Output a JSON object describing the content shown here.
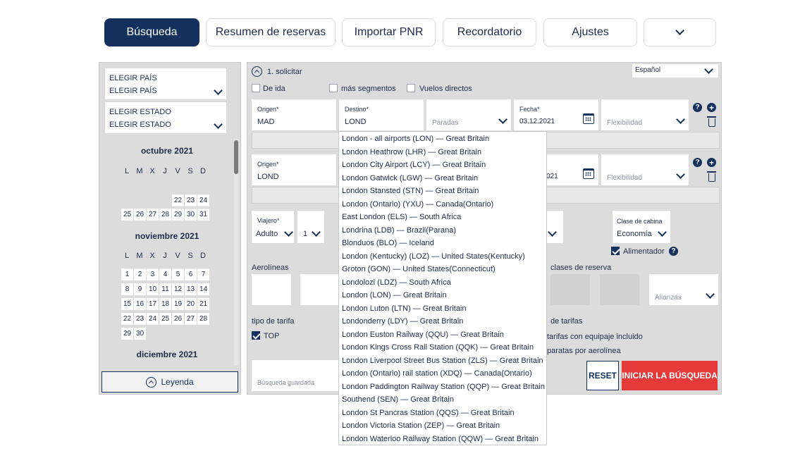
{
  "nav": {
    "tabs": [
      "Búsqueda",
      "Resumen de reservas",
      "Importar PNR",
      "Recordatorio",
      "Ajustes"
    ],
    "more_icon": "chevron-down-icon"
  },
  "sidebar": {
    "country_label": "ELEGIR PAÍS",
    "country_value": "ELEGIR PAÍS",
    "state_label": "ELEGIR ESTADO",
    "state_value": "ELEGIR ESTADO",
    "weekdays": [
      "L",
      "M",
      "X",
      "J",
      "V",
      "S",
      "D"
    ],
    "months": [
      {
        "title": "octubre 2021",
        "rows": [
          [
            "",
            "",
            "",
            "",
            "22",
            "23",
            "24"
          ],
          [
            "25",
            "26",
            "27",
            "28",
            "29",
            "30",
            "31"
          ]
        ]
      },
      {
        "title": "noviembre 2021",
        "rows": [
          [
            "1",
            "2",
            "3",
            "4",
            "5",
            "6",
            "7"
          ],
          [
            "8",
            "9",
            "10",
            "11",
            "12",
            "13",
            "14"
          ],
          [
            "15",
            "16",
            "17",
            "18",
            "19",
            "20",
            "21"
          ],
          [
            "22",
            "23",
            "24",
            "25",
            "26",
            "27",
            "28"
          ],
          [
            "29",
            "30",
            "",
            "",
            "",
            "",
            ""
          ]
        ]
      },
      {
        "title": "diciembre 2021",
        "rows": []
      }
    ],
    "legend": "Leyenda"
  },
  "main": {
    "section_title": "1. solicitar",
    "language": "Español",
    "options": {
      "oneway": "De ida",
      "more_segments": "más segmentos",
      "direct": "Vuelos directos"
    },
    "segment1": {
      "origin_label": "Origen*",
      "origin": "MAD",
      "dest_label": "Destino*",
      "dest": "LOND",
      "stops": "Paradas",
      "date_label": "Fecha*",
      "date": "03.12.2021",
      "flex": "Flexibilidad"
    },
    "segment2": {
      "origin_label": "Origen*",
      "origin": "LOND",
      "date_partial": "021",
      "flex": "Flexibilidad"
    },
    "traveler": {
      "label": "Viajero*",
      "type": "Adulto",
      "count": "1"
    },
    "cabin": {
      "label": "Clase de cabina",
      "value": "Economía"
    },
    "feeder": "Alimentador",
    "airlines_label": "Aerolíneas",
    "booking_classes": "clases de reserva",
    "alliances": "Alianzas",
    "fare_type_label": "tipo de tarifa",
    "top": "TOP",
    "fare_right_1": "de tarifas",
    "fare_right_2": "tarifas con equipaje incluido",
    "fare_right_3": "paratas por aerolínea",
    "saved_search": "Búsqueda guardada",
    "reset": "RESET",
    "start": "INICIAR LA BÚSQUEDA"
  },
  "dropdown": {
    "items": [
      "London - all airports (LON) — Great Britain",
      "London Heathrow (LHR) — Great Britain",
      "London City Airport (LCY) — Great Britain",
      "London Gatwick (LGW) — Great Britain",
      "London Stansted (STN) — Great Britain",
      "London (Ontario) (YXU) — Canada(Ontario)",
      "East London (ELS) — South Africa",
      "Londrina (LDB) — Brazil(Parana)",
      "Blonduos (BLO) — Iceland",
      "London (Kentucky) (LOZ) — United States(Kentucky)",
      "Groton (GON) — United States(Connecticut)",
      "Londolozi (LDZ) — South Africa",
      "London (LON) — Great Britain",
      "London Luton (LTN) — Great Britain",
      "Londonderry (LDY) — Great Britain",
      "London Euston Railway (QQU) — Great Britain",
      "London Kings Cross Rail Station (QQK) — Great Britain",
      "London Liverpool Street Bus Station (ZLS) — Great Britain",
      "London (Ontario) rail station (XDQ) — Canada(Ontario)",
      "London Paddington Railway Station (QQP) — Great Britain",
      "Southend (SEN) — Great Britain",
      "London St Pancras Station (QQS) — Great Britain",
      "London Victoria Station (ZEP) — Great Britain",
      "London Waterloo Railway Station (QQW) — Great Britain"
    ]
  },
  "colors": {
    "brand": "#13315c",
    "accent": "#e53a3a",
    "panel": "#dcdcdc"
  }
}
